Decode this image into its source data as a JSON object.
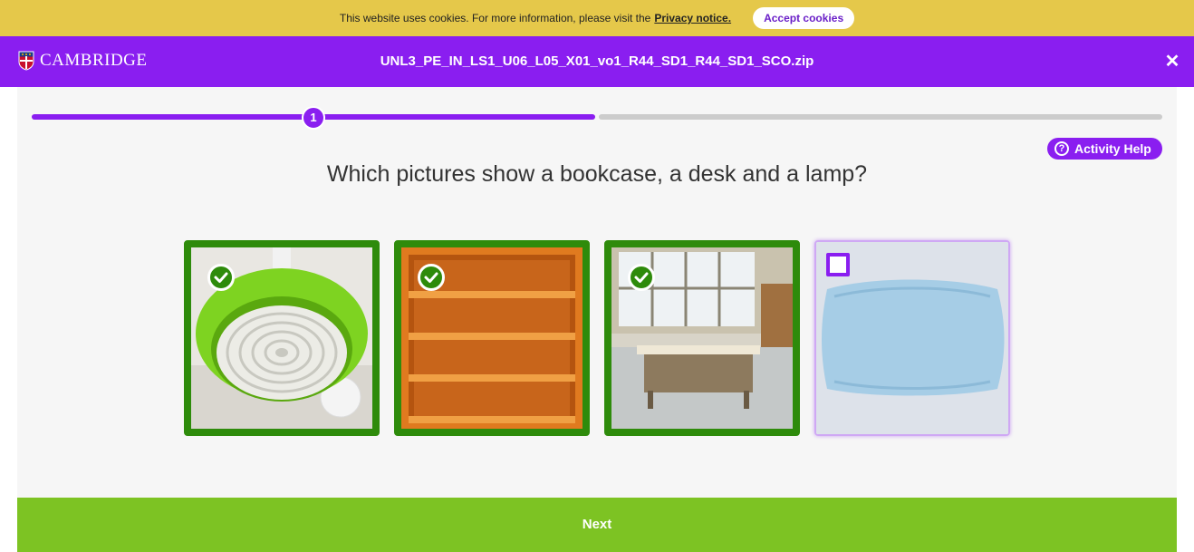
{
  "cookie_bar": {
    "message": "This website uses cookies. For more information, please visit the",
    "privacy_link": "Privacy notice.",
    "accept_label": "Accept cookies"
  },
  "header": {
    "logo_text": "CAMBRIDGE",
    "file_name": "UNL3_PE_IN_LS1_U06_L05_X01_vo1_R44_SD1_R44_SD1_SCO.zip",
    "close_icon": "close-icon"
  },
  "progress": {
    "current_step": "1",
    "fraction_complete": 0.5
  },
  "activity_help": {
    "label": "Activity Help",
    "icon": "question-circle-icon"
  },
  "question": "Which pictures show a bookcase, a desk and a lamp?",
  "options": [
    {
      "subject": "lamp",
      "selected": true
    },
    {
      "subject": "bookcase",
      "selected": true
    },
    {
      "subject": "desk",
      "selected": true
    },
    {
      "subject": "pillow",
      "selected": false
    }
  ],
  "colors": {
    "brand_purple": "#8a1ef0",
    "cookie_yellow": "#e5c84a",
    "selected_green": "#2e8b0b",
    "next_green": "#7dc323"
  },
  "footer": {
    "next_label": "Next"
  }
}
